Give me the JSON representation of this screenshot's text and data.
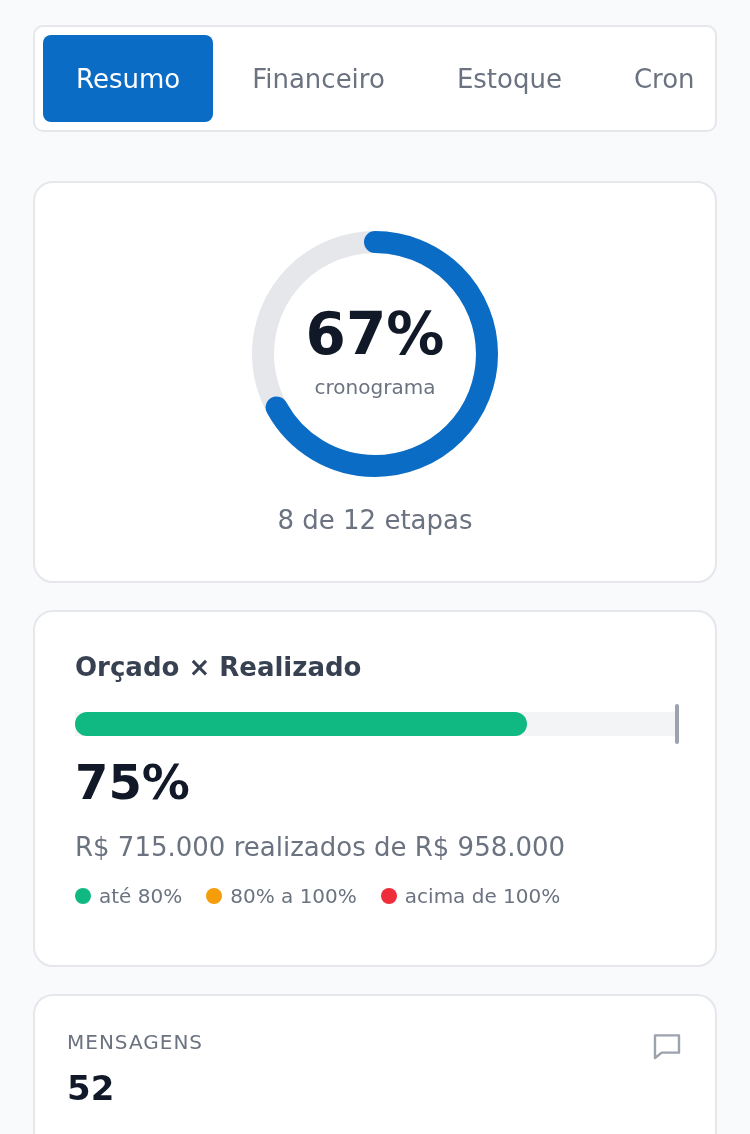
{
  "tabs": [
    {
      "label": "Resumo",
      "selected": true
    },
    {
      "label": "Financeiro",
      "selected": false
    },
    {
      "label": "Estoque",
      "selected": false
    },
    {
      "label": "Cron",
      "selected": false
    }
  ],
  "schedule": {
    "value": "67%",
    "caption": "cronograma",
    "steps": "8 de 12 etapas"
  },
  "budget": {
    "title": "Orçado × Realizado",
    "level": 0.75,
    "color": "#10b981",
    "value": "75%",
    "summary": "R$ 715.000 realizados de R$ 958.000",
    "legend": [
      {
        "label": "até 80%",
        "color": "#10b981"
      },
      {
        "label": "80% a 100%",
        "color": "#f59e0b"
      },
      {
        "label": "acima de 100%",
        "color": "#ef2d3a"
      }
    ]
  },
  "messages": {
    "label": "MENSAGENS",
    "value": "52"
  }
}
